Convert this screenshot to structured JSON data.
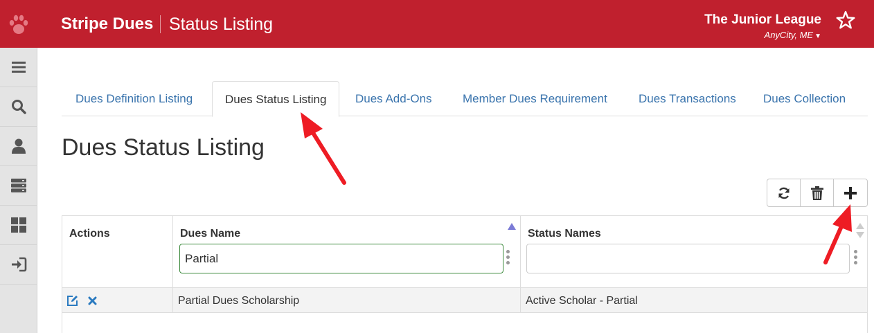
{
  "header": {
    "app_title": "Stripe Dues",
    "page_name": "Status Listing",
    "org_name": "The Junior League",
    "org_city": "AnyCity, ME",
    "accent_color": "#c0202e"
  },
  "sidebar": {
    "items": [
      {
        "icon": "menu-icon"
      },
      {
        "icon": "search-icon"
      },
      {
        "icon": "user-icon"
      },
      {
        "icon": "server-icon"
      },
      {
        "icon": "dashboard-icon"
      },
      {
        "icon": "sign-in-icon"
      }
    ]
  },
  "tabs": [
    {
      "label": "Dues Definition Listing",
      "active": false
    },
    {
      "label": "Dues Status Listing",
      "active": true
    },
    {
      "label": "Dues Add-Ons",
      "active": false
    },
    {
      "label": "Member Dues Requirement",
      "active": false
    },
    {
      "label": "Dues Transactions",
      "active": false
    },
    {
      "label": "Dues Collection",
      "active": false
    }
  ],
  "page": {
    "heading": "Dues Status Listing"
  },
  "toolbar": {
    "buttons": [
      {
        "icon": "refresh-icon"
      },
      {
        "icon": "trash-icon"
      },
      {
        "icon": "plus-icon"
      }
    ]
  },
  "table": {
    "columns": [
      {
        "label": "Actions"
      },
      {
        "label": "Dues Name",
        "filter_value": "Partial",
        "sort": "ascending"
      },
      {
        "label": "Status Names",
        "filter_value": "",
        "sort": "none"
      }
    ],
    "rows": [
      {
        "actions": [
          "edit-icon",
          "delete-icon"
        ],
        "dues_name": "Partial Dues Scholarship",
        "status_names": "Active Scholar - Partial"
      }
    ]
  }
}
